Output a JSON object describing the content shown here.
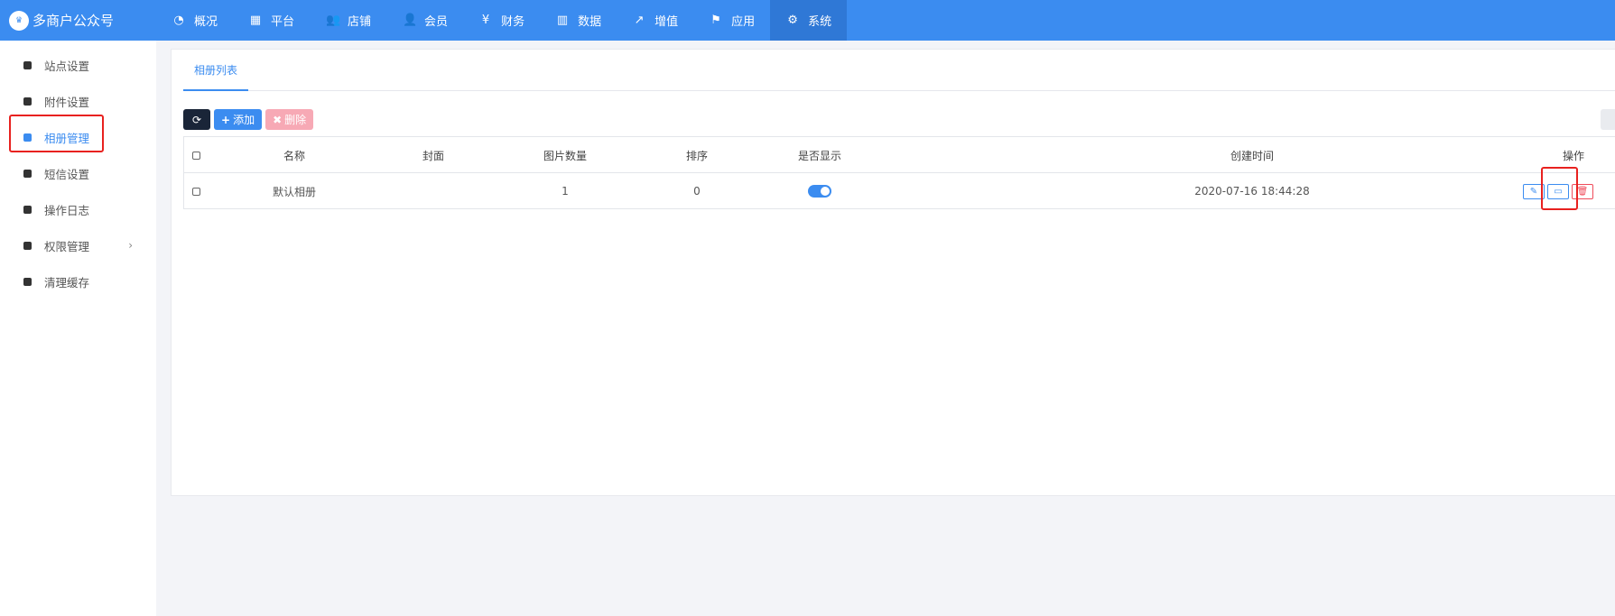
{
  "brand": {
    "title": "多商户公众号",
    "logo_icon": "crown-logo-icon"
  },
  "topnav": [
    {
      "label": "概况",
      "icon": "dashboard-icon",
      "glyph": "◔"
    },
    {
      "label": "平台",
      "icon": "grid-icon",
      "glyph": "▦"
    },
    {
      "label": "店铺",
      "icon": "users-icon",
      "glyph": "👥"
    },
    {
      "label": "会员",
      "icon": "user-add-icon",
      "glyph": "👤"
    },
    {
      "label": "财务",
      "icon": "yen-icon",
      "glyph": "¥"
    },
    {
      "label": "数据",
      "icon": "bar-chart-icon",
      "glyph": "▥"
    },
    {
      "label": "增值",
      "icon": "line-chart-icon",
      "glyph": "↗"
    },
    {
      "label": "应用",
      "icon": "flag-icon",
      "glyph": "⚑"
    },
    {
      "label": "系统",
      "icon": "gear-icon",
      "glyph": "⚙"
    }
  ],
  "active_topnav": "系统",
  "sidebar": {
    "items": [
      {
        "label": "站点设置",
        "icon": "eye-icon"
      },
      {
        "label": "附件设置",
        "icon": "folder-icon"
      },
      {
        "label": "相册管理",
        "icon": "album-icon"
      },
      {
        "label": "短信设置",
        "icon": "message-icon"
      },
      {
        "label": "操作日志",
        "icon": "log-icon"
      },
      {
        "label": "权限管理",
        "icon": "permission-icon",
        "arrow": "›"
      },
      {
        "label": "清理缓存",
        "icon": "cache-icon"
      }
    ],
    "active": "相册管理"
  },
  "main": {
    "tab_label": "相册列表",
    "toolbar": {
      "refresh_icon": "refresh-icon",
      "refresh_glyph": "⟳",
      "add_label": "添加",
      "add_glyph": "+",
      "delete_label": "删除",
      "delete_glyph": "✖"
    },
    "table": {
      "columns": [
        "名称",
        "封面",
        "图片数量",
        "排序",
        "是否显示",
        "创建时间",
        "操作"
      ],
      "rows": [
        {
          "name": "默认相册",
          "cover": "",
          "count": "1",
          "sort": "0",
          "visible": true,
          "created": "2020-07-16 18:44:28"
        }
      ],
      "row_actions": [
        {
          "icon": "pencil-icon",
          "glyph": "✎"
        },
        {
          "icon": "folder-open-icon",
          "glyph": "▭"
        },
        {
          "icon": "trash-icon",
          "glyph": "🗑"
        }
      ]
    }
  },
  "colors": {
    "primary": "#3b8cf0",
    "highlight": "#e8211f",
    "danger": "#ef4b5a",
    "dark": "#1a2538"
  }
}
